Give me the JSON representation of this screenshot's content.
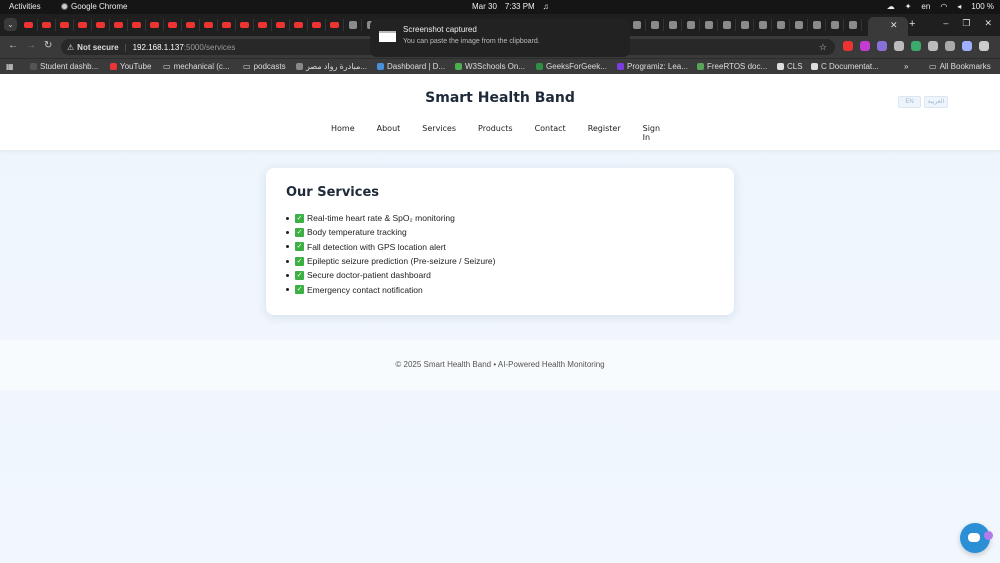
{
  "system_bar": {
    "activities": "Activities",
    "app_name": "Google Chrome",
    "date": "Mar 30",
    "time": "7:33 PM",
    "lang": "en",
    "battery": "100 %"
  },
  "notification": {
    "title": "Screenshot captured",
    "body": "You can paste the image from the clipboard."
  },
  "browser": {
    "not_secure": "Not secure",
    "host": "192.168.1.137",
    "path": ":5000/services",
    "bookmarks": [
      "Student dashb...",
      "YouTube",
      "mechanical (c...",
      "podcasts",
      "مبادرة رواد مصر...",
      "Dashboard | D...",
      "W3Schools On...",
      "GeeksForGeek...",
      "Programiz: Lea...",
      "FreeRTOS doc...",
      "CLS",
      "C Documentat..."
    ],
    "all_bookmarks": "All Bookmarks",
    "colors": {
      "tab_strip": "#1f1f1f",
      "toolbar": "#3a3a3a",
      "youtube_red": "#e33333"
    }
  },
  "site": {
    "brand": "Smart Health Band",
    "nav": [
      "Home",
      "About",
      "Services",
      "Products",
      "Contact",
      "Register",
      "Sign In"
    ],
    "lang_buttons": [
      "EN",
      "العربية"
    ],
    "services_title": "Our Services",
    "services": [
      "Real-time heart rate & SpO₂ monitoring",
      "Body temperature tracking",
      "Fall detection with GPS location alert",
      "Epileptic seizure prediction (Pre-seizure / Seizure)",
      "Secure doctor-patient dashboard",
      "Emergency contact notification"
    ],
    "footer": "© 2025 Smart Health Band • AI-Powered Health Monitoring",
    "colors": {
      "check_green": "#3cb043",
      "chat_blue": "#2b8fd6",
      "heading": "#1e2a3a"
    }
  }
}
